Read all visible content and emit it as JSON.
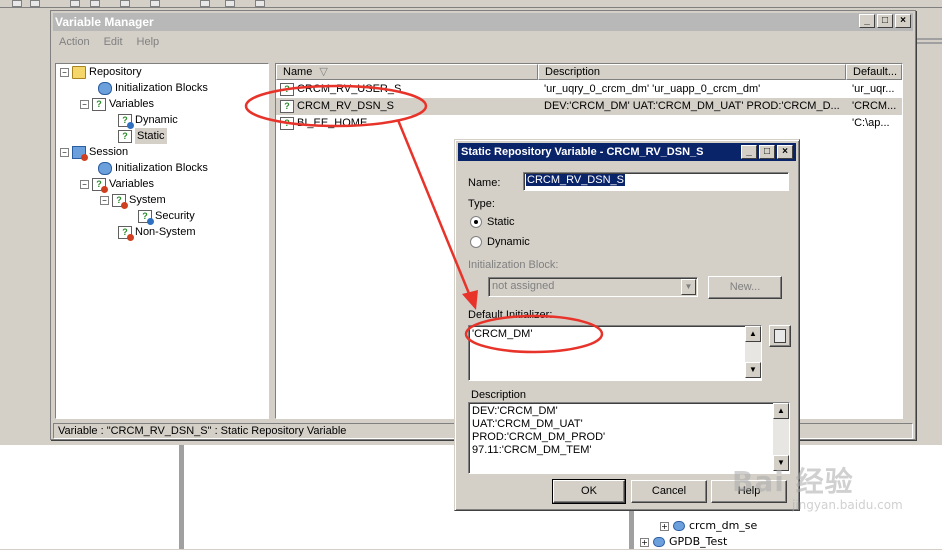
{
  "window": {
    "title": "Variable Manager",
    "menu": [
      "Action",
      "Edit",
      "Help"
    ],
    "controls": {
      "minimize": "_",
      "maximize": "□",
      "close": "×"
    }
  },
  "tree": {
    "repository": "Repository",
    "repo_init_blocks": "Initialization Blocks",
    "repo_variables": "Variables",
    "dynamic": "Dynamic",
    "static": "Static",
    "session": "Session",
    "sess_init_blocks": "Initialization Blocks",
    "sess_variables": "Variables",
    "system": "System",
    "security": "Security",
    "non_system": "Non-System"
  },
  "list": {
    "columns": [
      "Name",
      "Description",
      "Default..."
    ],
    "rows": [
      {
        "name": "CRCM_RV_USER_S",
        "description": "'ur_uqry_0_crcm_dm' 'ur_uapp_0_crcm_dm'",
        "default": "'ur_uqr..."
      },
      {
        "name": "CRCM_RV_DSN_S",
        "description": "DEV:'CRCM_DM' UAT:'CRCM_DM_UAT' PROD:'CRCM_D...",
        "default": "'CRCM..."
      },
      {
        "name": "BI_EE_HOME",
        "description": "",
        "default": "'C:\\ap..."
      }
    ]
  },
  "status": "Variable : \"CRCM_RV_DSN_S\" : Static Repository Variable",
  "dialog": {
    "title": "Static Repository Variable - CRCM_RV_DSN_S",
    "name_label": "Name:",
    "name_value": "CRCM_RV_DSN_S",
    "type_label": "Type:",
    "type_static": "Static",
    "type_dynamic": "Dynamic",
    "init_block_label": "Initialization Block:",
    "init_block_value": "not assigned",
    "new_button": "New...",
    "default_init_label": "Default Initializer:",
    "default_init_value": "'CRCM_DM'",
    "description_label": "Description",
    "description_lines": [
      "DEV:'CRCM_DM'",
      "UAT:'CRCM_DM_UAT'",
      "PROD:'CRCM_DM_PROD'",
      "97.11:'CRCM_DM_TEM'"
    ],
    "ok": "OK",
    "cancel": "Cancel",
    "help": "Help"
  },
  "background": {
    "tree_item_1": "crcm_dm_se",
    "tree_item_2": "GPDB_Test"
  },
  "watermark": {
    "main": "Bai 经验",
    "sub": "jingyan.baidu.com"
  },
  "colors": {
    "annotation_red": "#e8332a",
    "selection_blue": "#0a246a",
    "title_inactive": "#b8b8b8"
  }
}
